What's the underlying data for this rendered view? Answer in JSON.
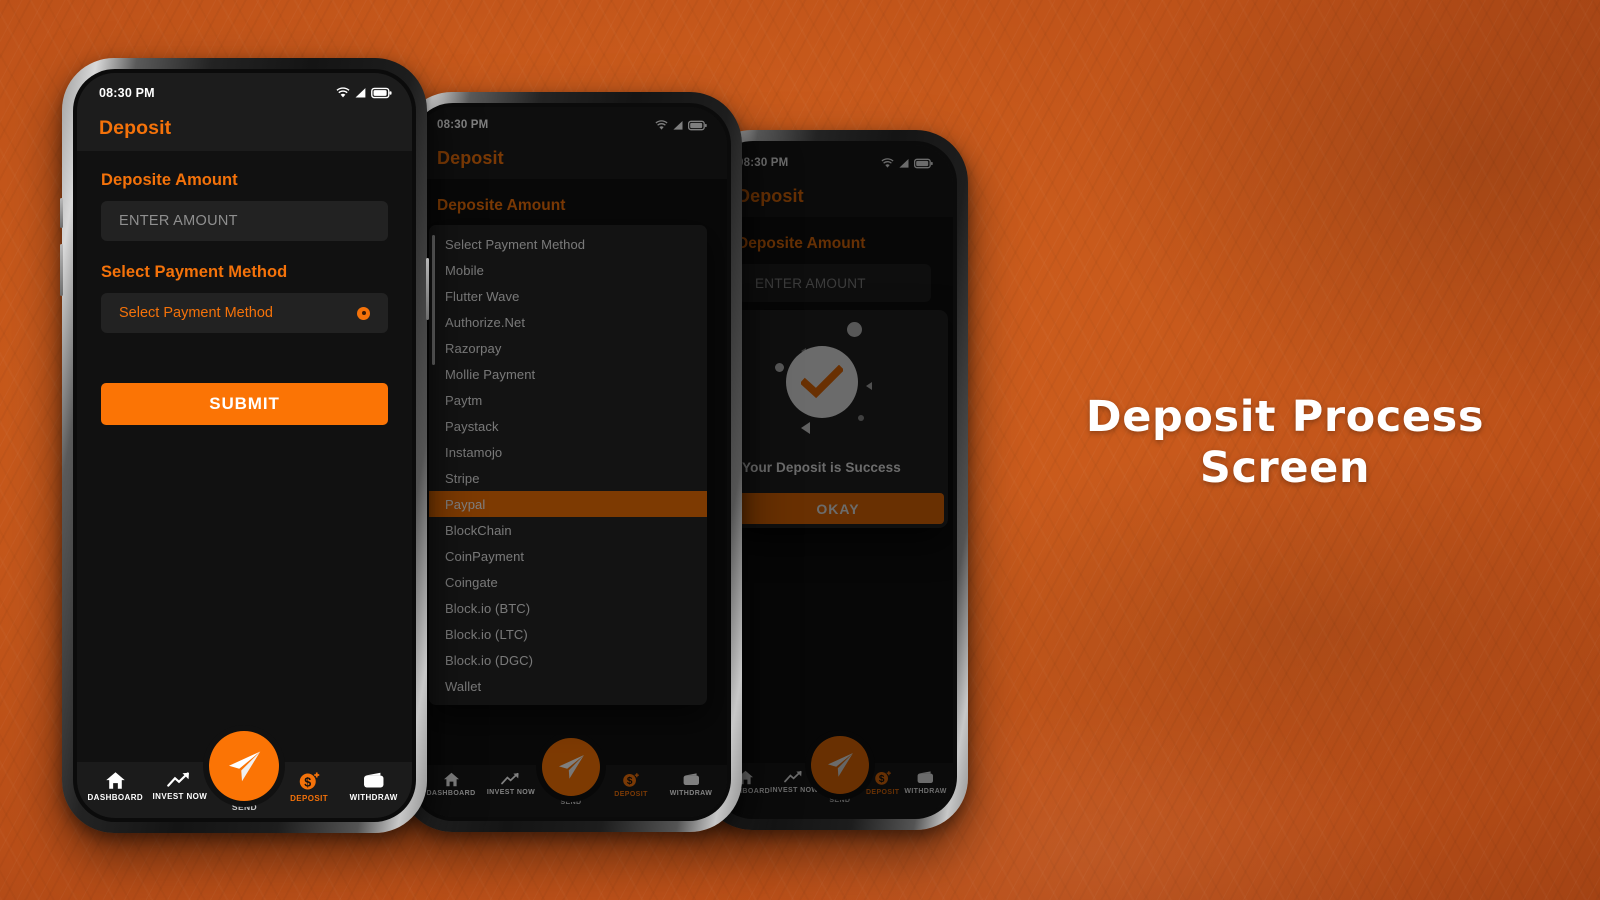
{
  "poster": {
    "headline_line1": "Deposit Process",
    "headline_line2": "Screen",
    "background_color": "#c95a1c",
    "background_edge_color": "#83330e",
    "accent_color": "#fb7405",
    "screen_bg_color": "#111111"
  },
  "app": {
    "status_bar": {
      "time": "08:30 PM",
      "icons": [
        "wifi-icon",
        "signal-icon",
        "battery-icon"
      ]
    },
    "app_bar": {
      "title": "Deposit"
    },
    "deposit_form": {
      "amount_label": "Deposite Amount",
      "amount_value": "",
      "amount_placeholder": "ENTER AMOUNT",
      "method_label": "Select Payment Method",
      "method_value": "Select Payment Method",
      "method_caret_icon": "dropdown-dot-icon",
      "submit_label": "SUBMIT"
    },
    "payment_methods": {
      "selected": "Paypal",
      "options": [
        "Select Payment Method",
        "Mobile",
        "Flutter Wave",
        "Authorize.Net",
        "Razorpay",
        "Mollie Payment",
        "Paytm",
        "Paystack",
        "Instamojo",
        "Stripe",
        "Paypal",
        "BlockChain",
        "CoinPayment",
        "Coingate",
        "Block.io (BTC)",
        "Block.io (LTC)",
        "Block.io (DGC)",
        "Wallet"
      ]
    },
    "success_dialog": {
      "check_icon": "check-circle-icon",
      "message": "Your Deposit is Success",
      "okay_label": "OKAY"
    },
    "bottom_nav": {
      "items": [
        {
          "label": "DASHBOARD",
          "icon": "home-icon",
          "active": false
        },
        {
          "label": "INVEST NOW",
          "icon": "trending-up-icon",
          "active": false
        },
        {
          "label": "SEND",
          "icon": "paper-plane-icon",
          "active": false,
          "fab": true
        },
        {
          "label": "DEPOSIT",
          "icon": "dollar-coin-icon",
          "active": true
        },
        {
          "label": "WITHDRAW",
          "icon": "wallet-icon",
          "active": false
        }
      ]
    }
  }
}
